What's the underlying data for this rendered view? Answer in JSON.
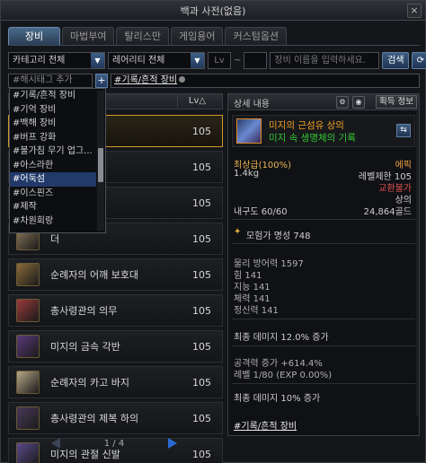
{
  "window": {
    "title": "백과 사전(없음)",
    "close_glyph": "×"
  },
  "tabs": [
    {
      "label": "장비",
      "active": true
    },
    {
      "label": "마법부여",
      "active": false
    },
    {
      "label": "탈리스만",
      "active": false
    },
    {
      "label": "게임용어",
      "active": false
    },
    {
      "label": "커스텀옵션",
      "active": false
    }
  ],
  "filters": {
    "category": "카테고리 전체",
    "rarity": "레어리티 전체",
    "lv_label": "Lv",
    "lv_sep": "~",
    "search_placeholder": "장비 이름을 입력하세요.",
    "search_button": "검색",
    "refresh_glyph": "⟳"
  },
  "tagbar": {
    "placeholder": "#해시태그 추가",
    "add_glyph": "+",
    "selected_tag": "#기록/흔적 장비"
  },
  "list": {
    "lv_header": "Lv△",
    "rows": [
      {
        "name": "상의",
        "lv": "105",
        "selected": true,
        "icon_color": "#3a4a7a"
      },
      {
        "name": "바람 막이",
        "lv": "105",
        "selected": false,
        "icon_color": "#6a4a2a"
      },
      {
        "name": "복 상의",
        "lv": "105",
        "selected": false,
        "icon_color": "#7a6a4a"
      },
      {
        "name": "더",
        "lv": "105",
        "selected": false,
        "icon_color": "#8a7a5a"
      },
      {
        "name": "순례자의 어깨 보호대",
        "lv": "105",
        "selected": false,
        "icon_color": "#8a6a3a"
      },
      {
        "name": "총사령관의 의무",
        "lv": "105",
        "selected": false,
        "icon_color": "#9a3a3a"
      },
      {
        "name": "미지의 금속 각반",
        "lv": "105",
        "selected": false,
        "icon_color": "#5a3a7a"
      },
      {
        "name": "순례자의 카고 바지",
        "lv": "105",
        "selected": false,
        "icon_color": "#b8a888"
      },
      {
        "name": "총사령관의 제복 하의",
        "lv": "105",
        "selected": false,
        "icon_color": "#4a3a5a"
      },
      {
        "name": "미지의 관절 신발",
        "lv": "105",
        "selected": false,
        "icon_color": "#5a4a8a"
      }
    ],
    "pager": {
      "text": "1 / 4"
    }
  },
  "dropdown": {
    "items": [
      {
        "label": "#기록/흔적 장비",
        "highlight": false
      },
      {
        "label": "#기억 장비",
        "highlight": false
      },
      {
        "label": "#백해 장비",
        "highlight": false
      },
      {
        "label": "#버프 강화",
        "highlight": false
      },
      {
        "label": "#불가침 무기 업그...",
        "highlight": false
      },
      {
        "label": "#아스라한",
        "highlight": false
      },
      {
        "label": "#어둑섬",
        "highlight": true
      },
      {
        "label": "#이스핀즈",
        "highlight": false
      },
      {
        "label": "#제작",
        "highlight": false
      },
      {
        "label": "#차원회랑",
        "highlight": false
      }
    ]
  },
  "detail": {
    "header": "상세 내용",
    "obtain_button": "획득 정보",
    "item_name": "미지의 근섬유 상의",
    "item_sub": "미지 속 생명체의 기록",
    "swap_glyph": "⇆",
    "grade": "최상급(100%)",
    "rarity": "에픽",
    "weight": "1.4kg",
    "level_limit": "레벨제한 105",
    "trade": "교환불가",
    "slot": "상의",
    "durability": "내구도 60/60",
    "price": "24,864골드",
    "fame": "모험가 명성 748",
    "stats": [
      "물리 방어력 1597",
      "힘 141",
      "지능 141",
      "체력 141",
      "정신력 141"
    ],
    "final_damage_1": "최종 데미지 12.0% 증가",
    "attack_inc": "공격력 증가 +614.4%",
    "level_exp": "레벨 1/80 (EXP 0.00%)",
    "final_damage_2": "최종 데미지 10% 증가",
    "footer_tag": "#기록/흔적 장비"
  }
}
